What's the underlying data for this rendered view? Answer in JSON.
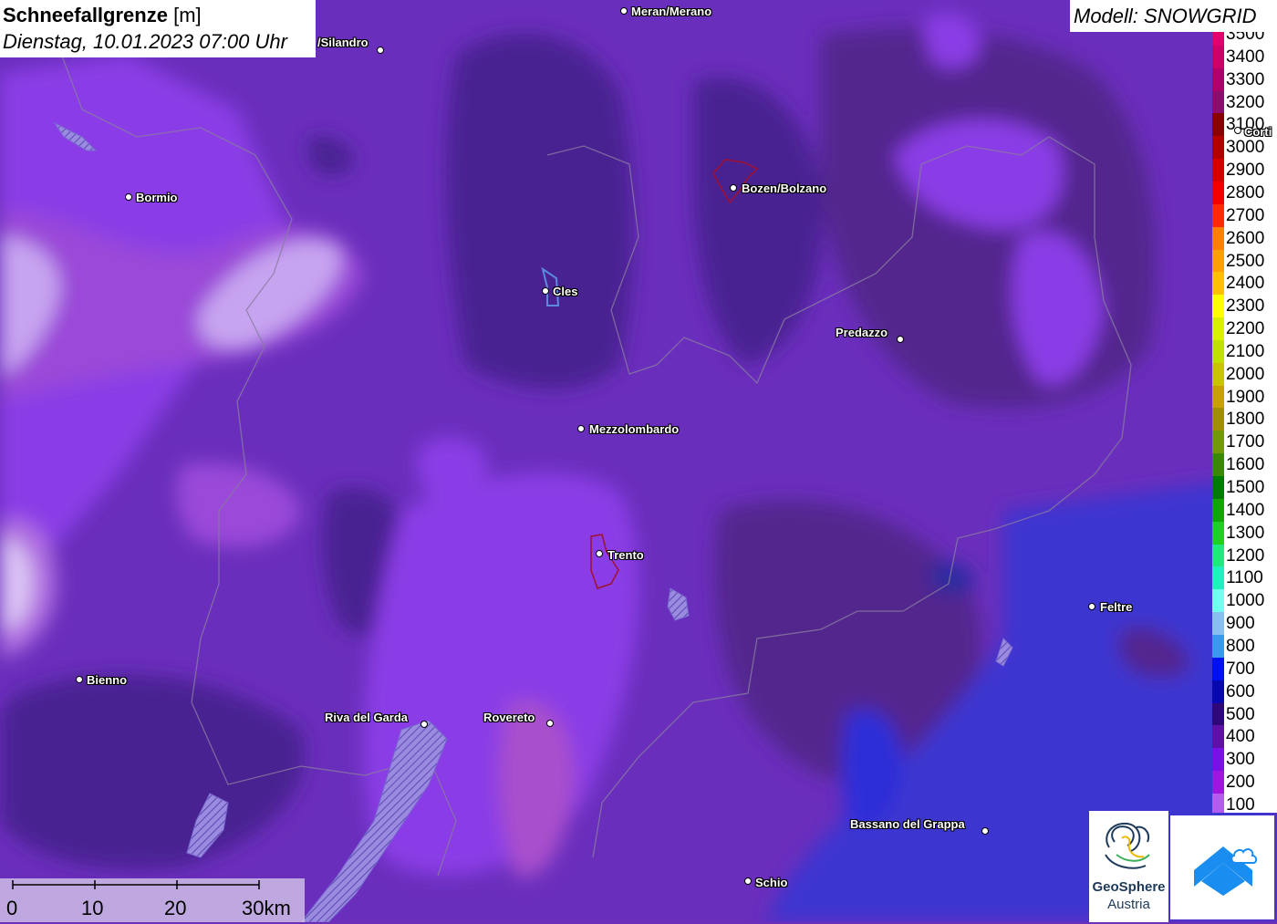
{
  "title": {
    "name": "Schneefallgrenze",
    "unit": "[m]",
    "datetime": "Dienstag, 10.01.2023 07:00 Uhr"
  },
  "model_label": "Modell: SNOWGRID",
  "legend": [
    {
      "label": "3500",
      "color": "#e0006e"
    },
    {
      "label": "3400",
      "color": "#cc0066"
    },
    {
      "label": "3300",
      "color": "#b0006a"
    },
    {
      "label": "3200",
      "color": "#8e0c6e"
    },
    {
      "label": "3100",
      "color": "#8b0000"
    },
    {
      "label": "3000",
      "color": "#b00000"
    },
    {
      "label": "2900",
      "color": "#d40000"
    },
    {
      "label": "2800",
      "color": "#f00000"
    },
    {
      "label": "2700",
      "color": "#ff2a00"
    },
    {
      "label": "2600",
      "color": "#ff8000"
    },
    {
      "label": "2500",
      "color": "#ffa000"
    },
    {
      "label": "2400",
      "color": "#ffc000"
    },
    {
      "label": "2300",
      "color": "#ffff00"
    },
    {
      "label": "2200",
      "color": "#d8f000"
    },
    {
      "label": "2100",
      "color": "#c0e000"
    },
    {
      "label": "2000",
      "color": "#c8c400"
    },
    {
      "label": "1900",
      "color": "#c8a000"
    },
    {
      "label": "1800",
      "color": "#a09000"
    },
    {
      "label": "1700",
      "color": "#709a00"
    },
    {
      "label": "1600",
      "color": "#3a8a00"
    },
    {
      "label": "1500",
      "color": "#007a00"
    },
    {
      "label": "1400",
      "color": "#10a800"
    },
    {
      "label": "1300",
      "color": "#20d020"
    },
    {
      "label": "1200",
      "color": "#20e880"
    },
    {
      "label": "1100",
      "color": "#20f0c0"
    },
    {
      "label": "1000",
      "color": "#70fff0"
    },
    {
      "label": "900",
      "color": "#88bff0"
    },
    {
      "label": "800",
      "color": "#3a98f0"
    },
    {
      "label": "700",
      "color": "#0010f0"
    },
    {
      "label": "600",
      "color": "#0808b0"
    },
    {
      "label": "500",
      "color": "#2e0878"
    },
    {
      "label": "400",
      "color": "#5e10a8"
    },
    {
      "label": "300",
      "color": "#7a10e8"
    },
    {
      "label": "200",
      "color": "#9a18e0"
    },
    {
      "label": "100",
      "color": "#b45cf0"
    }
  ],
  "cities": [
    {
      "name": "Meran/Merano"
    },
    {
      "name": "/Silandro"
    },
    {
      "name": "Bormio"
    },
    {
      "name": "Bozen/Bolzano"
    },
    {
      "name": "Cles"
    },
    {
      "name": "Predazzo"
    },
    {
      "name": "Mezzolombardo"
    },
    {
      "name": "Trento"
    },
    {
      "name": "Feltre"
    },
    {
      "name": "Bienno"
    },
    {
      "name": "Riva del Garda"
    },
    {
      "name": "Rovereto"
    },
    {
      "name": "Bassano del Grappa"
    },
    {
      "name": "Schio"
    },
    {
      "name": "Corti"
    }
  ],
  "scale_bar": {
    "labels": [
      "0",
      "10",
      "20",
      "30km"
    ]
  },
  "logos": {
    "geosphere_name": "GeoSphere",
    "geosphere_sub": "Austria"
  }
}
